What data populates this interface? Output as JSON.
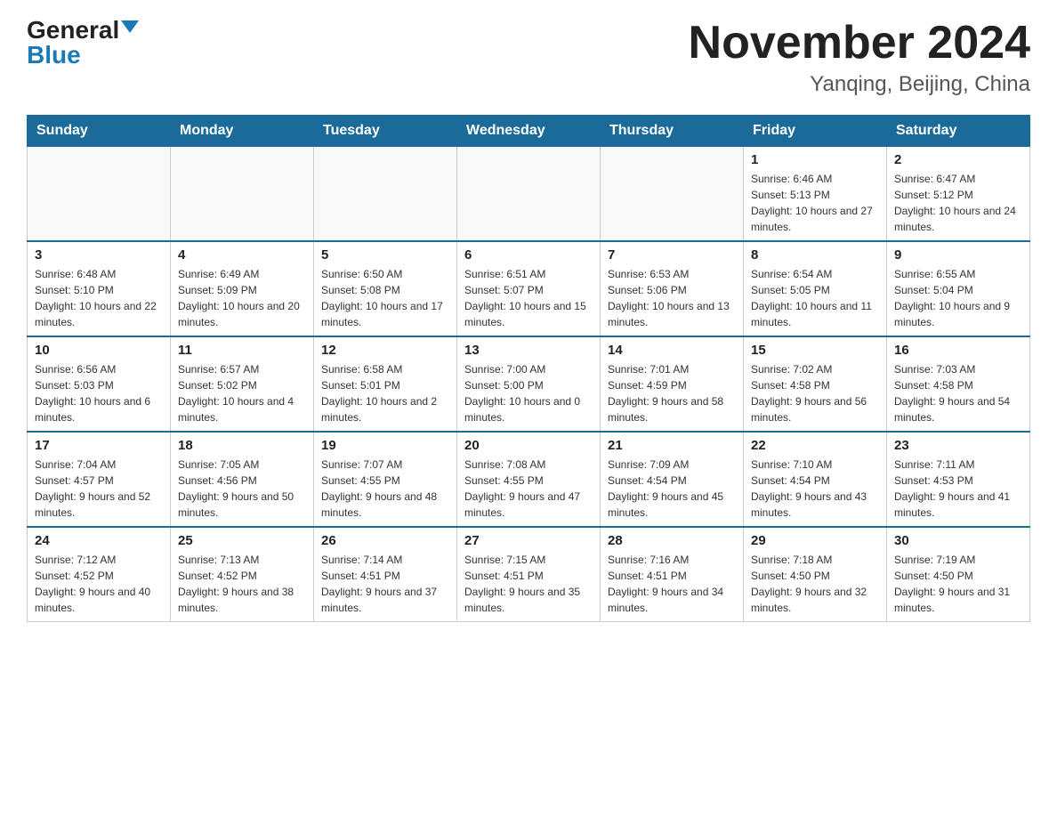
{
  "header": {
    "logo_general": "General",
    "logo_blue": "Blue",
    "title": "November 2024",
    "subtitle": "Yanqing, Beijing, China"
  },
  "days_of_week": [
    "Sunday",
    "Monday",
    "Tuesday",
    "Wednesday",
    "Thursday",
    "Friday",
    "Saturday"
  ],
  "weeks": [
    [
      {
        "day": "",
        "info": ""
      },
      {
        "day": "",
        "info": ""
      },
      {
        "day": "",
        "info": ""
      },
      {
        "day": "",
        "info": ""
      },
      {
        "day": "",
        "info": ""
      },
      {
        "day": "1",
        "info": "Sunrise: 6:46 AM\nSunset: 5:13 PM\nDaylight: 10 hours and 27 minutes."
      },
      {
        "day": "2",
        "info": "Sunrise: 6:47 AM\nSunset: 5:12 PM\nDaylight: 10 hours and 24 minutes."
      }
    ],
    [
      {
        "day": "3",
        "info": "Sunrise: 6:48 AM\nSunset: 5:10 PM\nDaylight: 10 hours and 22 minutes."
      },
      {
        "day": "4",
        "info": "Sunrise: 6:49 AM\nSunset: 5:09 PM\nDaylight: 10 hours and 20 minutes."
      },
      {
        "day": "5",
        "info": "Sunrise: 6:50 AM\nSunset: 5:08 PM\nDaylight: 10 hours and 17 minutes."
      },
      {
        "day": "6",
        "info": "Sunrise: 6:51 AM\nSunset: 5:07 PM\nDaylight: 10 hours and 15 minutes."
      },
      {
        "day": "7",
        "info": "Sunrise: 6:53 AM\nSunset: 5:06 PM\nDaylight: 10 hours and 13 minutes."
      },
      {
        "day": "8",
        "info": "Sunrise: 6:54 AM\nSunset: 5:05 PM\nDaylight: 10 hours and 11 minutes."
      },
      {
        "day": "9",
        "info": "Sunrise: 6:55 AM\nSunset: 5:04 PM\nDaylight: 10 hours and 9 minutes."
      }
    ],
    [
      {
        "day": "10",
        "info": "Sunrise: 6:56 AM\nSunset: 5:03 PM\nDaylight: 10 hours and 6 minutes."
      },
      {
        "day": "11",
        "info": "Sunrise: 6:57 AM\nSunset: 5:02 PM\nDaylight: 10 hours and 4 minutes."
      },
      {
        "day": "12",
        "info": "Sunrise: 6:58 AM\nSunset: 5:01 PM\nDaylight: 10 hours and 2 minutes."
      },
      {
        "day": "13",
        "info": "Sunrise: 7:00 AM\nSunset: 5:00 PM\nDaylight: 10 hours and 0 minutes."
      },
      {
        "day": "14",
        "info": "Sunrise: 7:01 AM\nSunset: 4:59 PM\nDaylight: 9 hours and 58 minutes."
      },
      {
        "day": "15",
        "info": "Sunrise: 7:02 AM\nSunset: 4:58 PM\nDaylight: 9 hours and 56 minutes."
      },
      {
        "day": "16",
        "info": "Sunrise: 7:03 AM\nSunset: 4:58 PM\nDaylight: 9 hours and 54 minutes."
      }
    ],
    [
      {
        "day": "17",
        "info": "Sunrise: 7:04 AM\nSunset: 4:57 PM\nDaylight: 9 hours and 52 minutes."
      },
      {
        "day": "18",
        "info": "Sunrise: 7:05 AM\nSunset: 4:56 PM\nDaylight: 9 hours and 50 minutes."
      },
      {
        "day": "19",
        "info": "Sunrise: 7:07 AM\nSunset: 4:55 PM\nDaylight: 9 hours and 48 minutes."
      },
      {
        "day": "20",
        "info": "Sunrise: 7:08 AM\nSunset: 4:55 PM\nDaylight: 9 hours and 47 minutes."
      },
      {
        "day": "21",
        "info": "Sunrise: 7:09 AM\nSunset: 4:54 PM\nDaylight: 9 hours and 45 minutes."
      },
      {
        "day": "22",
        "info": "Sunrise: 7:10 AM\nSunset: 4:54 PM\nDaylight: 9 hours and 43 minutes."
      },
      {
        "day": "23",
        "info": "Sunrise: 7:11 AM\nSunset: 4:53 PM\nDaylight: 9 hours and 41 minutes."
      }
    ],
    [
      {
        "day": "24",
        "info": "Sunrise: 7:12 AM\nSunset: 4:52 PM\nDaylight: 9 hours and 40 minutes."
      },
      {
        "day": "25",
        "info": "Sunrise: 7:13 AM\nSunset: 4:52 PM\nDaylight: 9 hours and 38 minutes."
      },
      {
        "day": "26",
        "info": "Sunrise: 7:14 AM\nSunset: 4:51 PM\nDaylight: 9 hours and 37 minutes."
      },
      {
        "day": "27",
        "info": "Sunrise: 7:15 AM\nSunset: 4:51 PM\nDaylight: 9 hours and 35 minutes."
      },
      {
        "day": "28",
        "info": "Sunrise: 7:16 AM\nSunset: 4:51 PM\nDaylight: 9 hours and 34 minutes."
      },
      {
        "day": "29",
        "info": "Sunrise: 7:18 AM\nSunset: 4:50 PM\nDaylight: 9 hours and 32 minutes."
      },
      {
        "day": "30",
        "info": "Sunrise: 7:19 AM\nSunset: 4:50 PM\nDaylight: 9 hours and 31 minutes."
      }
    ]
  ]
}
